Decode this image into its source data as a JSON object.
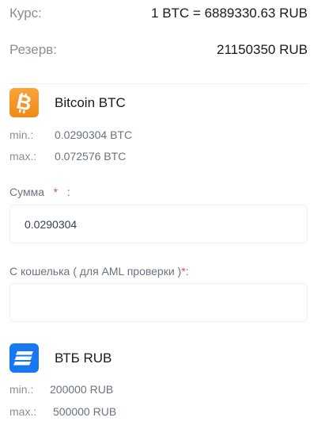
{
  "rate": {
    "label": "Курс:",
    "value": "1 BTC = 6889330.63 RUB"
  },
  "reserve": {
    "label": "Резерв:",
    "value": "21150350 RUB"
  },
  "give": {
    "name": "Bitcoin BTC",
    "icon": "bitcoin-icon",
    "min_label": "min.:",
    "min_value": "0.0290304 BTC",
    "max_label": "max.:",
    "max_value": "0.072576 BTC"
  },
  "amount_field": {
    "label": "Сумма",
    "required": "*",
    "suffix": ":",
    "value": "0.0290304"
  },
  "wallet_field": {
    "label": "С кошелька ( для AML проверки )",
    "required": "*",
    "suffix": ":",
    "value": ""
  },
  "receive": {
    "name": "ВТБ RUB",
    "icon": "vtb-bank-icon",
    "min_label": "min.:",
    "min_value": "200000 RUB",
    "max_label": "max.:",
    "max_value": "500000 RUB"
  },
  "colors": {
    "bitcoin": "#f7931a",
    "vtb": "#1877f2",
    "required": "#e5484d"
  }
}
